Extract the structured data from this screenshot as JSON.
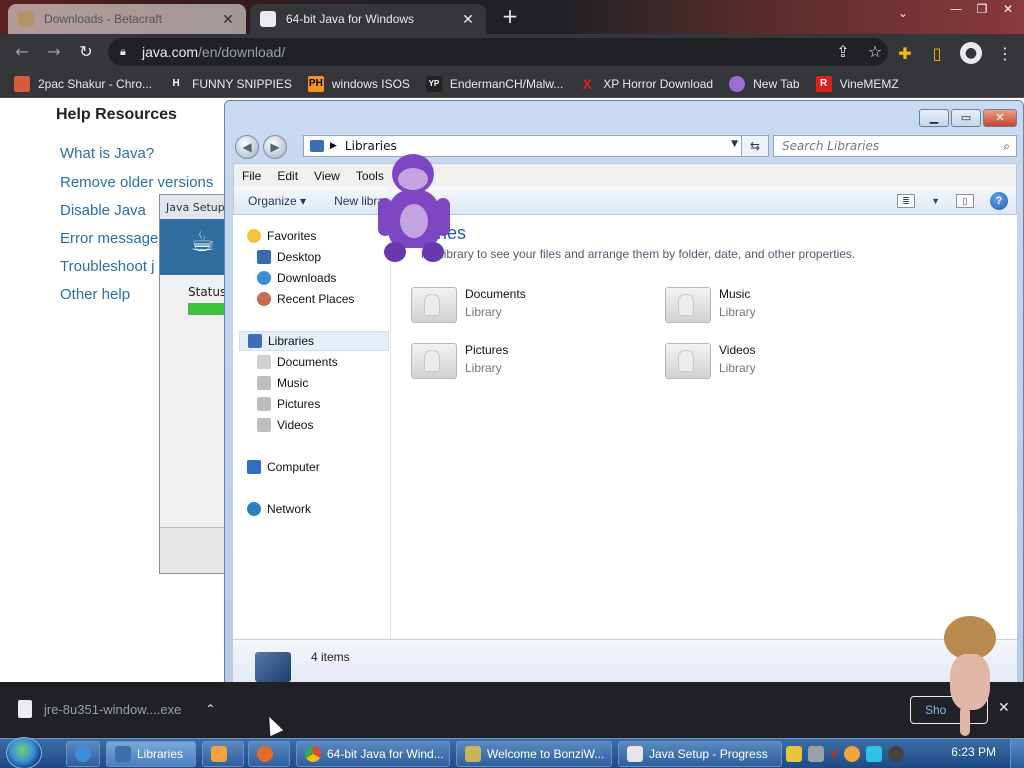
{
  "browser": {
    "tabs": [
      {
        "title": "Downloads - Betacraft",
        "close": "✕"
      },
      {
        "title": "64-bit Java for Windows",
        "close": "✕"
      }
    ],
    "new_tab": "+",
    "window_controls": [
      "⌄",
      "—",
      "❐",
      "✕"
    ],
    "address_domain": "java.com",
    "address_path": "/en/download/",
    "bookmarks": [
      {
        "label": "2pac Shakur - Chro...",
        "badge": "",
        "color": "#d85a3a"
      },
      {
        "label": "FUNNY SNIPPIES",
        "badge": "H",
        "color": "#ffffff"
      },
      {
        "label": "windows ISOS",
        "badge": "PH",
        "color": "#f7931e"
      },
      {
        "label": "EndermanCH/Malw...",
        "badge": "YP",
        "color": "#333333"
      },
      {
        "label": "XP Horror Download",
        "badge": "X",
        "color": "#e0201a"
      },
      {
        "label": "New Tab",
        "badge": "",
        "color": "#9b6bd6"
      },
      {
        "label": "VineMEMZ",
        "badge": "R",
        "color": "#e0201a"
      }
    ]
  },
  "java_page": {
    "heading": "Help Resources",
    "links": [
      "What is Java?",
      "Remove older versions",
      "Disable Java",
      "Error message",
      "Troubleshoot j",
      "Other help"
    ]
  },
  "java_setup": {
    "title": "Java Setup",
    "status": "Status"
  },
  "explorer": {
    "location": "Libraries",
    "search_placeholder": "Search Libraries",
    "menu": [
      "File",
      "Edit",
      "View",
      "Tools"
    ],
    "commands": [
      "Organize ▾",
      "New libra"
    ],
    "nav": {
      "favorites": "Favorites",
      "fav_items": [
        "Desktop",
        "Downloads",
        "Recent Places"
      ],
      "libraries": "Libraries",
      "lib_items": [
        "Documents",
        "Music",
        "Pictures",
        "Videos"
      ],
      "computer": "Computer",
      "network": "Network"
    },
    "content_title": "raries",
    "content_desc": "n a library to see your files and arrange them by folder, date, and other properties.",
    "libraries": [
      {
        "name": "Documents",
        "type": "Library"
      },
      {
        "name": "Music",
        "type": "Library"
      },
      {
        "name": "Pictures",
        "type": "Library"
      },
      {
        "name": "Videos",
        "type": "Library"
      }
    ],
    "status": "4 items"
  },
  "download_bar": {
    "filename": "jre-8u351-window....exe",
    "show_all": "Sho",
    "close": "✕"
  },
  "taskbar": {
    "items": [
      "Libraries",
      "64-bit Java for Wind...",
      "Welcome to BonziW...",
      "Java Setup - Progress"
    ],
    "clock": "6:23 PM"
  }
}
